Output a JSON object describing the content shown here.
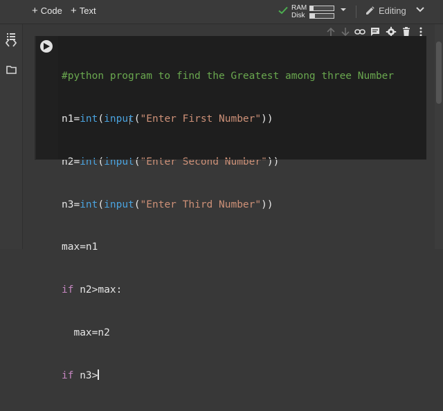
{
  "toolbar": {
    "code_label": "Code",
    "text_label": "Text",
    "ram_label": "RAM",
    "disk_label": "Disk",
    "ram_usage": 0.15,
    "disk_usage": 0.22,
    "editing_label": "Editing"
  },
  "icons": {
    "connected": "check-icon",
    "toc": "table-of-contents-icon",
    "code_snippets": "code-brackets-icon",
    "files": "folder-icon",
    "cell_actions": [
      "arrow-up-icon",
      "arrow-down-icon",
      "link-icon",
      "comment-icon",
      "gear-icon",
      "trash-icon",
      "more-vert-icon"
    ]
  },
  "colors": {
    "background": "#383838",
    "editor": "#1e1e1e",
    "comment": "#6aa84f",
    "builtin": "#4aa3df",
    "string": "#ce9178",
    "keyword": "#c586c0",
    "connected": "#4caf50"
  },
  "code": {
    "line1": {
      "comment": "#python program to find the Greatest among three Number"
    },
    "line2": {
      "lhs": "n1=",
      "fn1": "int",
      "p1": "(",
      "fn2": "input",
      "p2": "(",
      "str": "\"Enter First Number\"",
      "close": "))"
    },
    "line3": {
      "lhs": "n2=",
      "fn1": "int",
      "p1": "(",
      "fn2": "input",
      "p2": "(",
      "str": "\"Enter Second Number\"",
      "close": "))"
    },
    "line4": {
      "lhs": "n3=",
      "fn1": "int",
      "p1": "(",
      "fn2": "input",
      "p2": "(",
      "str": "\"Enter Third Number\"",
      "close": "))"
    },
    "line5": {
      "text": "max=n1"
    },
    "line6": {
      "kw": "if",
      "rest": " n2>max:"
    },
    "line7": {
      "indent": "  ",
      "text": "max=n2"
    },
    "line8": {
      "kw": "if",
      "rest": " n3>"
    }
  }
}
